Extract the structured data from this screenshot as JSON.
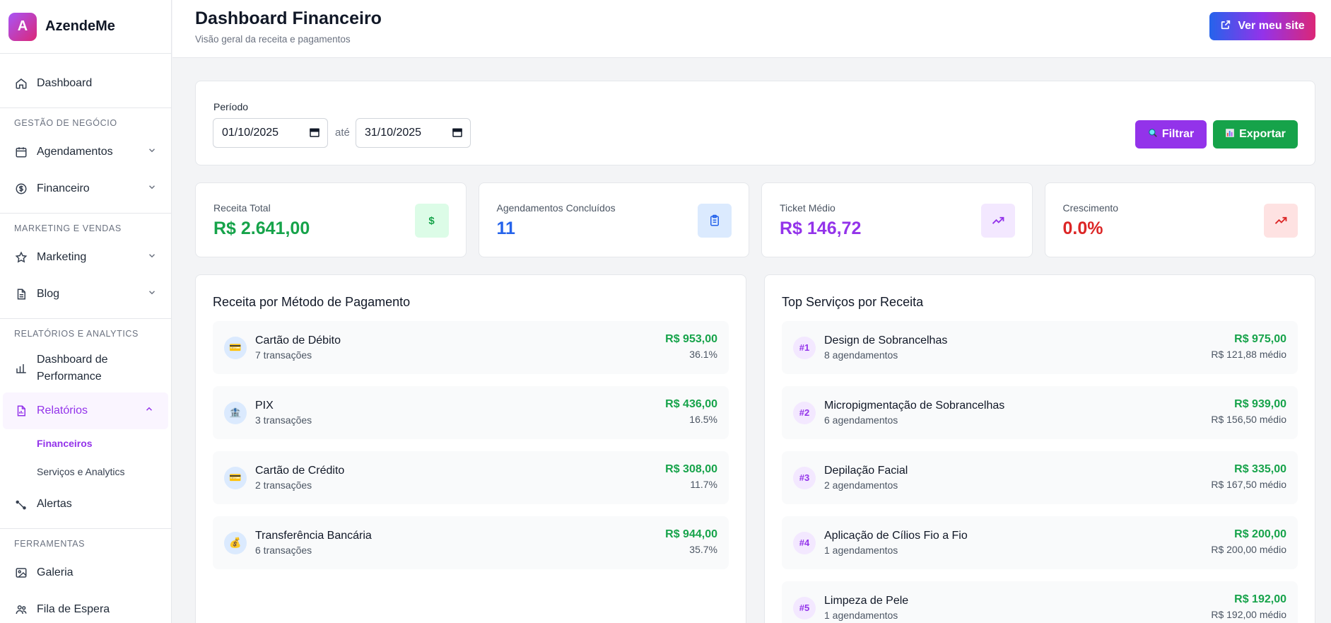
{
  "brand": {
    "logo_letter": "A",
    "name": "AzendeMe"
  },
  "sidebar": {
    "dashboard": "Dashboard",
    "section_business": "GESTÃO DE NEGÓCIO",
    "agendamentos": "Agendamentos",
    "financeiro": "Financeiro",
    "section_marketing": "MARKETING E VENDAS",
    "marketing": "Marketing",
    "blog": "Blog",
    "section_reports": "RELATÓRIOS E ANALYTICS",
    "performance": "Dashboard de Performance",
    "relatorios": "Relatórios",
    "sub_financeiros": "Financeiros",
    "sub_servicos": "Serviços e Analytics",
    "alertas": "Alertas",
    "section_tools": "FERRAMENTAS",
    "galeria": "Galeria",
    "fila": "Fila de Espera"
  },
  "header": {
    "title": "Dashboard Financeiro",
    "subtitle": "Visão geral da receita e pagamentos",
    "site_button": "Ver meu site"
  },
  "filter": {
    "label": "Período",
    "start": "01/10/2025",
    "separator": "até",
    "end": "31/10/2025",
    "filter_button": "Filtrar",
    "export_button": "Exportar"
  },
  "stats": [
    {
      "label": "Receita Total",
      "value": "R$ 2.641,00",
      "icon": "$",
      "color": "#16a34a",
      "bg": "#dcfce7"
    },
    {
      "label": "Agendamentos Concluídos",
      "value": "11",
      "icon": "clipboard-icon",
      "color": "#2563eb",
      "bg": "#dbeafe"
    },
    {
      "label": "Ticket Médio",
      "value": "R$ 146,72",
      "icon": "trend-up-icon",
      "color": "#9333ea",
      "bg": "#f3e8ff"
    },
    {
      "label": "Crescimento",
      "value": "0.0%",
      "icon": "trend-up-icon",
      "color": "#dc2626",
      "bg": "#fee2e2"
    }
  ],
  "payments": {
    "title": "Receita por Método de Pagamento",
    "rows": [
      {
        "icon": "💳",
        "name": "Cartão de Débito",
        "sub": "7 transações",
        "amount": "R$ 953,00",
        "pct": "36.1%"
      },
      {
        "icon": "🏦",
        "name": "PIX",
        "sub": "3 transações",
        "amount": "R$ 436,00",
        "pct": "16.5%"
      },
      {
        "icon": "💳",
        "name": "Cartão de Crédito",
        "sub": "2 transações",
        "amount": "R$ 308,00",
        "pct": "11.7%"
      },
      {
        "icon": "💰",
        "name": "Transferência Bancária",
        "sub": "6 transações",
        "amount": "R$ 944,00",
        "pct": "35.7%"
      }
    ]
  },
  "services": {
    "title": "Top Serviços por Receita",
    "rows": [
      {
        "rank": "#1",
        "name": "Design de Sobrancelhas",
        "sub": "8 agendamentos",
        "amount": "R$ 975,00",
        "avg": "R$ 121,88 médio"
      },
      {
        "rank": "#2",
        "name": "Micropigmentação de Sobrancelhas",
        "sub": "6 agendamentos",
        "amount": "R$ 939,00",
        "avg": "R$ 156,50 médio"
      },
      {
        "rank": "#3",
        "name": "Depilação Facial",
        "sub": "2 agendamentos",
        "amount": "R$ 335,00",
        "avg": "R$ 167,50 médio"
      },
      {
        "rank": "#4",
        "name": "Aplicação de Cílios Fio a Fio",
        "sub": "1 agendamentos",
        "amount": "R$ 200,00",
        "avg": "R$ 200,00 médio"
      },
      {
        "rank": "#5",
        "name": "Limpeza de Pele",
        "sub": "1 agendamentos",
        "amount": "R$ 192,00",
        "avg": "R$ 192,00 médio"
      }
    ]
  }
}
